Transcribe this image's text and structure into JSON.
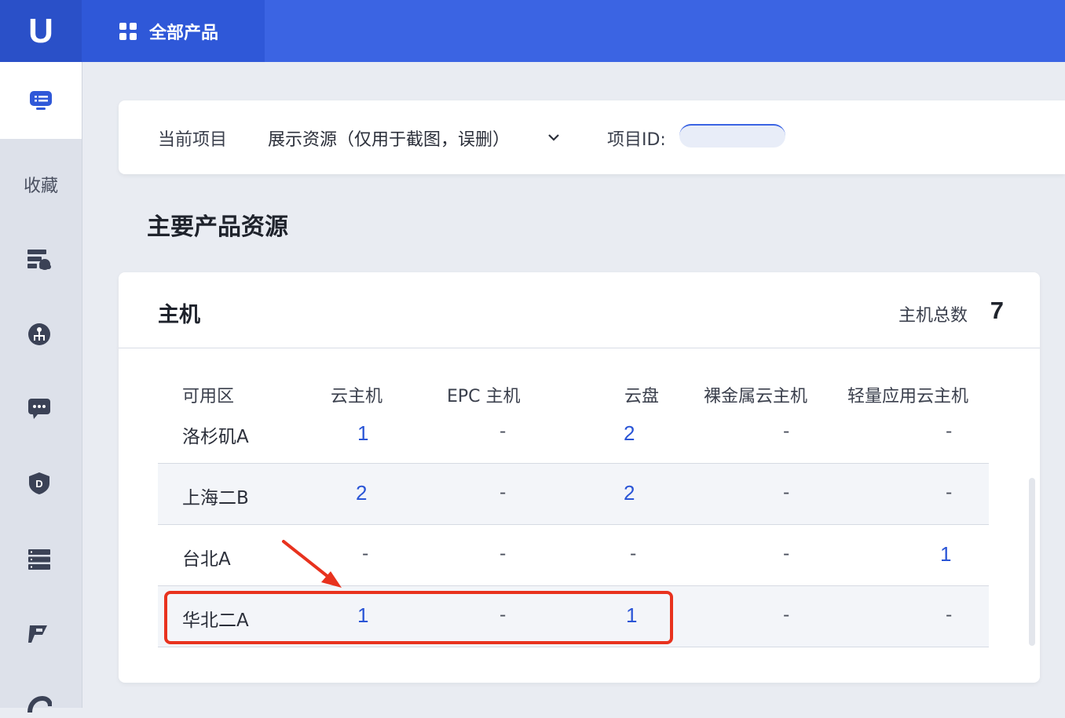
{
  "header": {
    "logo": "U",
    "all_products_label": "全部产品",
    "all_products_icon": "grid-icon"
  },
  "sidebar": {
    "favorites_label": "收藏",
    "icons": [
      "monitor-icon",
      "server-cloud-icon",
      "network-icon",
      "message-icon",
      "shield-icon",
      "list-icon",
      "plugin-icon",
      "hook-icon"
    ]
  },
  "project": {
    "label": "当前项目",
    "name": "展示资源（仅用于截图，误删）",
    "id_label": "项目ID:",
    "id_value": ""
  },
  "section": {
    "title": "主要产品资源"
  },
  "host_card": {
    "title": "主机",
    "total_label": "主机总数",
    "total_value": "7",
    "columns": [
      "可用区",
      "云主机",
      "EPC 主机",
      "云盘",
      "裸金属云主机",
      "轻量应用云主机"
    ],
    "rows": [
      {
        "zone": "洛杉矶A",
        "cloud_host": "1",
        "epc_host": "-",
        "cloud_disk": "2",
        "bare_metal": "-",
        "light_app": "-"
      },
      {
        "zone": "上海二B",
        "cloud_host": "2",
        "epc_host": "-",
        "cloud_disk": "2",
        "bare_metal": "-",
        "light_app": "-"
      },
      {
        "zone": "台北A",
        "cloud_host": "-",
        "epc_host": "-",
        "cloud_disk": "-",
        "bare_metal": "-",
        "light_app": "1"
      },
      {
        "zone": "华北二A",
        "cloud_host": "1",
        "epc_host": "-",
        "cloud_disk": "1",
        "bare_metal": "-",
        "light_app": "-"
      }
    ]
  },
  "annotation": {
    "highlight_color": "#e8321e"
  },
  "colors": {
    "brand_blue": "#3b64e3",
    "link_blue": "#2a55d6"
  }
}
